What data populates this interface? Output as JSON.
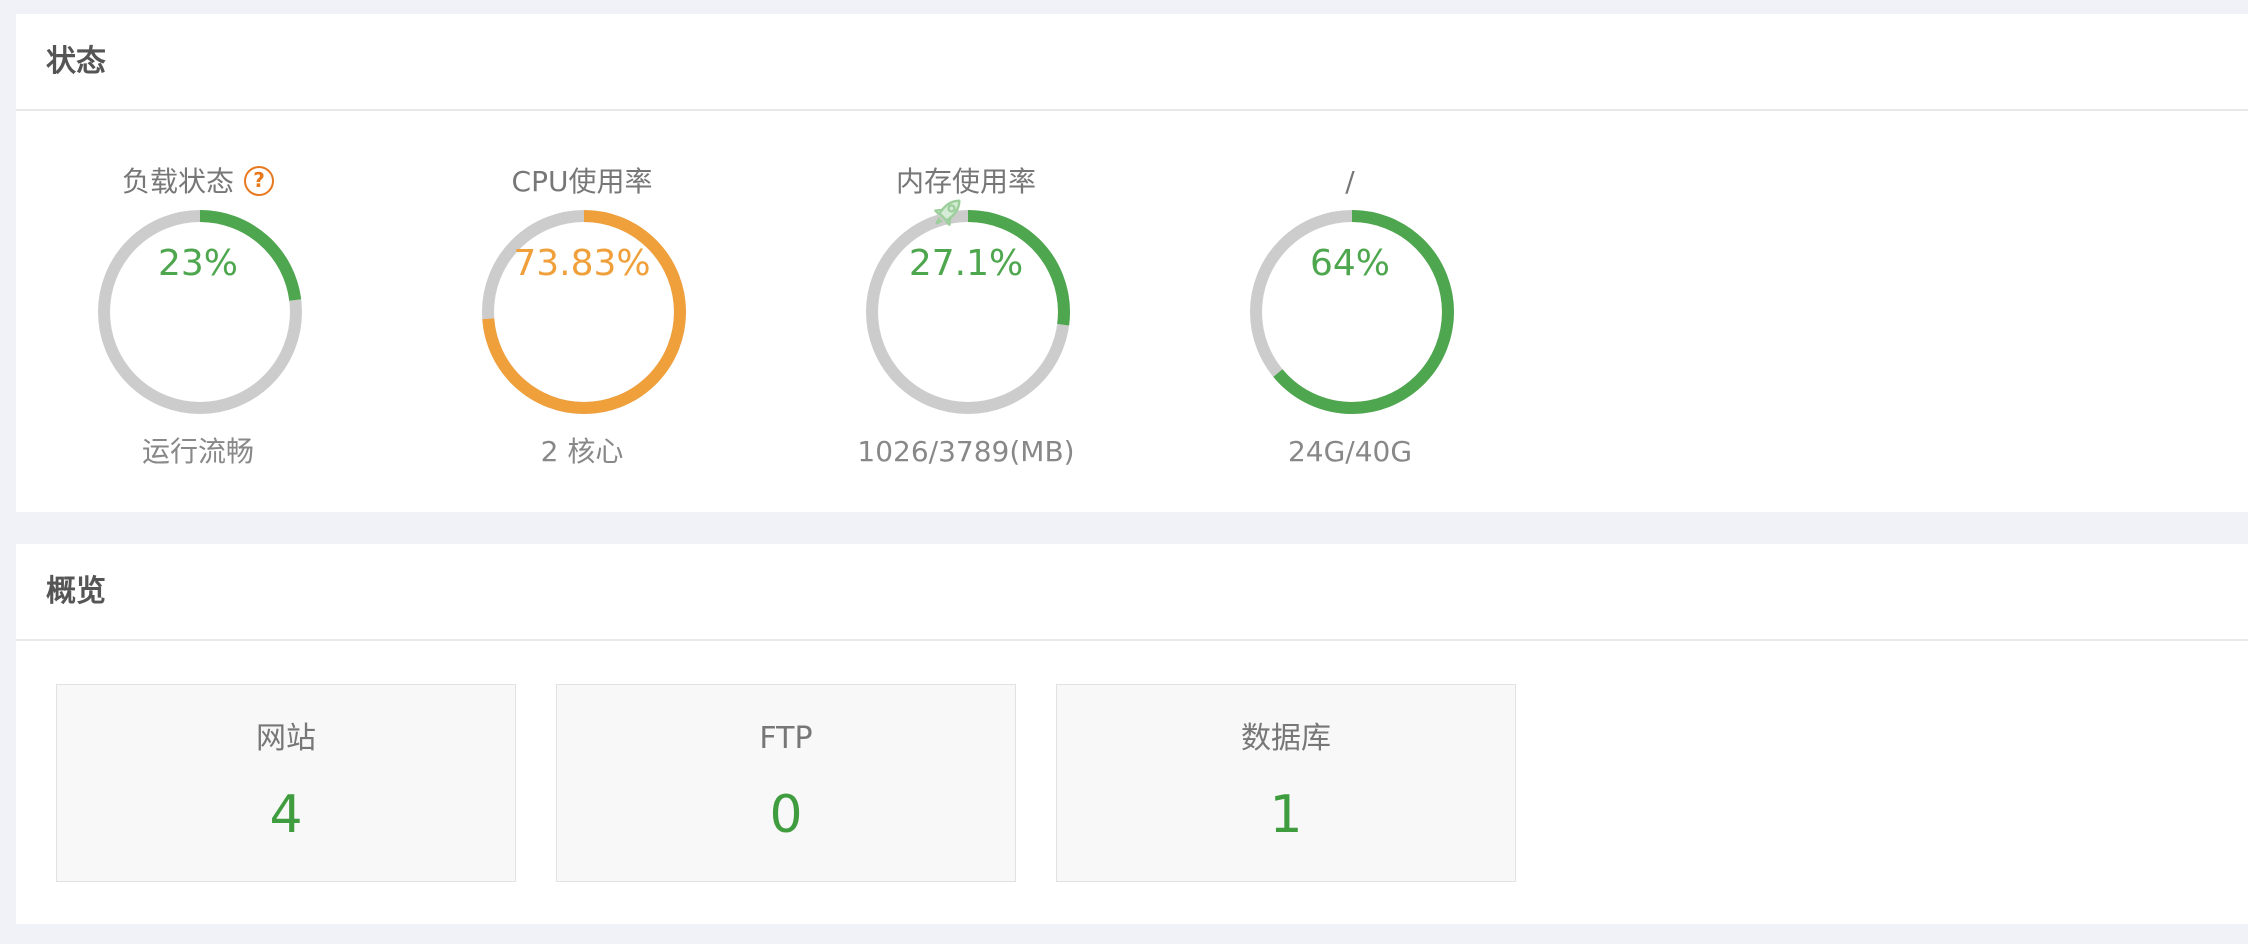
{
  "colors": {
    "green": "#4ea64e",
    "orange": "#f0a03a",
    "track": "#cccccc",
    "help": "#e8781e"
  },
  "status_panel": {
    "title": "状态",
    "gauges": [
      {
        "title": "负载状态",
        "has_help": true,
        "help_icon": "question-circle-icon",
        "help_symbol": "?",
        "value": "23%",
        "percent": 23,
        "color": "#4ea64e",
        "sub": "运行流畅"
      },
      {
        "title": "CPU使用率",
        "has_help": false,
        "value": "73.83%",
        "percent": 73.83,
        "color": "#f0a03a",
        "sub": "2 核心"
      },
      {
        "title": "内存使用率",
        "has_help": false,
        "has_rocket": true,
        "rocket_icon": "rocket-icon",
        "value": "27.1%",
        "percent": 27.1,
        "color": "#4ea64e",
        "sub": "1026/3789(MB)"
      },
      {
        "title": "/",
        "has_help": false,
        "value": "64%",
        "percent": 64,
        "color": "#4ea64e",
        "sub": "24G/40G"
      }
    ]
  },
  "overview_panel": {
    "title": "概览",
    "cards": [
      {
        "label": "网站",
        "value": "4"
      },
      {
        "label": "FTP",
        "value": "0"
      },
      {
        "label": "数据库",
        "value": "1"
      }
    ]
  }
}
